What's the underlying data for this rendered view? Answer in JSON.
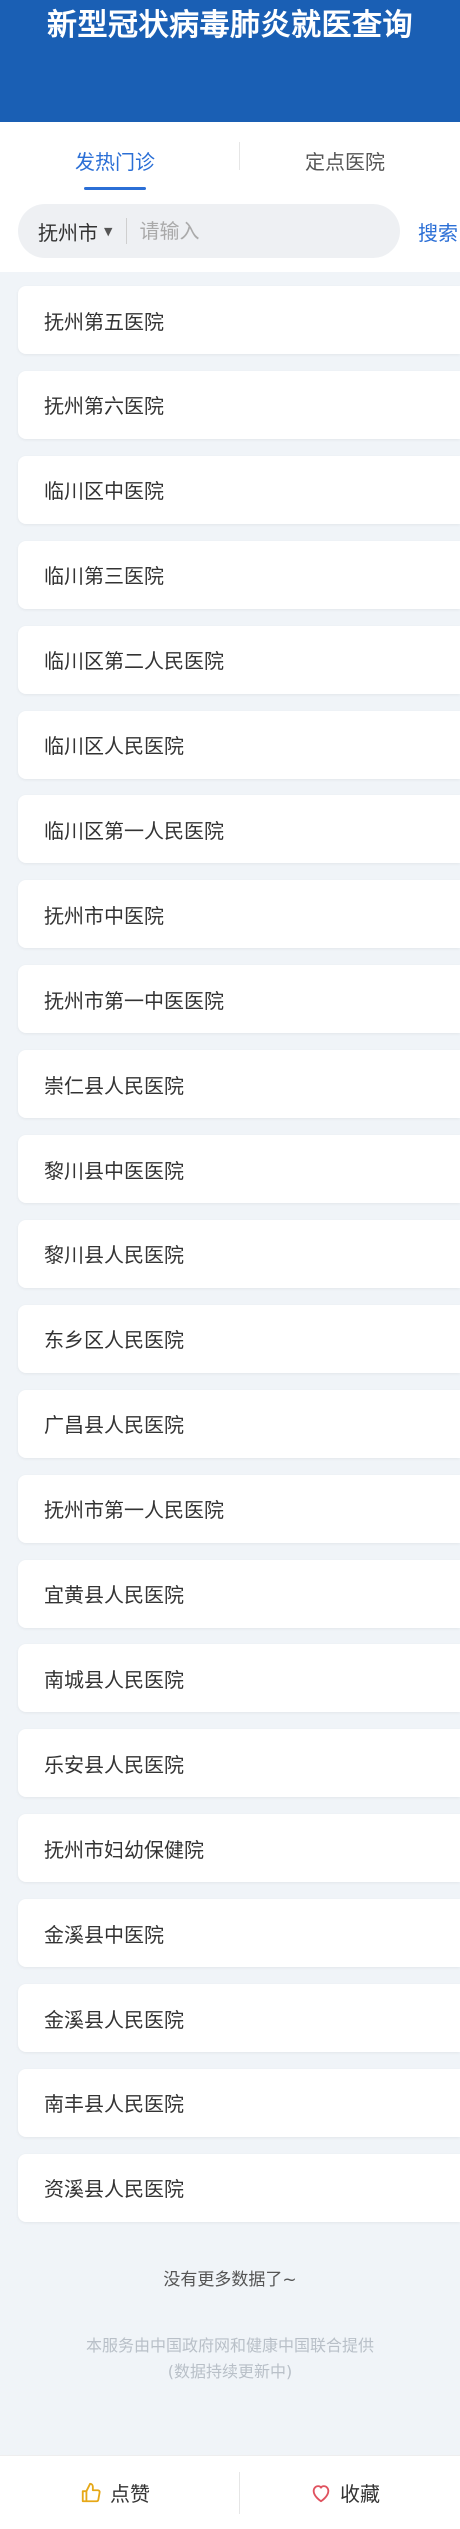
{
  "header": {
    "title": "新型冠状病毒肺炎就医查询"
  },
  "tabs": [
    {
      "label": "发热门诊",
      "active": true
    },
    {
      "label": "定点医院",
      "active": false
    }
  ],
  "search": {
    "city": "抚州市",
    "placeholder": "请输入",
    "value": "",
    "button_label": "搜索"
  },
  "hospitals": [
    "抚州第五医院",
    "抚州第六医院",
    "临川区中医院",
    "临川第三医院",
    "临川区第二人民医院",
    "临川区人民医院",
    "临川区第一人民医院",
    "抚州市中医院",
    "抚州市第一中医医院",
    "崇仁县人民医院",
    "黎川县中医医院",
    "黎川县人民医院",
    "东乡区人民医院",
    "广昌县人民医院",
    "抚州市第一人民医院",
    "宜黄县人民医院",
    "南城县人民医院",
    "乐安县人民医院",
    "抚州市妇幼保健院",
    "金溪县中医院",
    "金溪县人民医院",
    "南丰县人民医院",
    "资溪县人民医院"
  ],
  "list_end_text": "没有更多数据了~",
  "footnote": {
    "line1": "本服务由中国政府网和健康中国联合提供",
    "line2": "(数据持续更新中)"
  },
  "bottom_bar": {
    "like_label": "点赞",
    "favorite_label": "收藏"
  },
  "colors": {
    "header_bg": "#1a5fb4",
    "accent": "#2b6fd6",
    "page_bg": "#f0f4f8"
  },
  "icons": {
    "city_dropdown": "caret-down-icon",
    "like": "thumbs-up-icon",
    "favorite": "heart-icon"
  }
}
